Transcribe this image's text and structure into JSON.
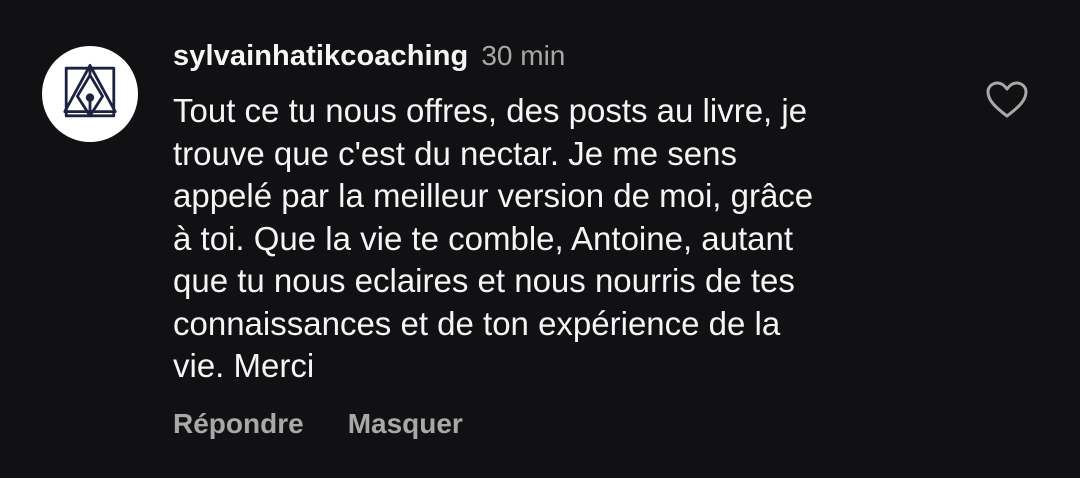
{
  "comment": {
    "username": "sylvainhatikcoaching",
    "timestamp": "30 min",
    "text": "Tout ce tu nous offres, des posts au livre, je\ntrouve que c'est du nectar. Je me sens\nappelé par la meilleur version de moi, grâce\nà toi. Que la vie te comble, Antoine, autant\nque tu nous eclaires et nous nourris de tes\nconnaissances et de ton expérience de la\nvie. Merci",
    "actions": {
      "reply_label": "Répondre",
      "hide_label": "Masquer"
    },
    "avatar_icon": "pen-nib-logo-icon",
    "like_icon": "heart-outline-icon"
  },
  "colors": {
    "background": "#111114",
    "text_primary": "#f5f5f5",
    "text_secondary": "#a8a8a8",
    "avatar_background": "#ffffff",
    "avatar_logo": "#1c2340"
  }
}
